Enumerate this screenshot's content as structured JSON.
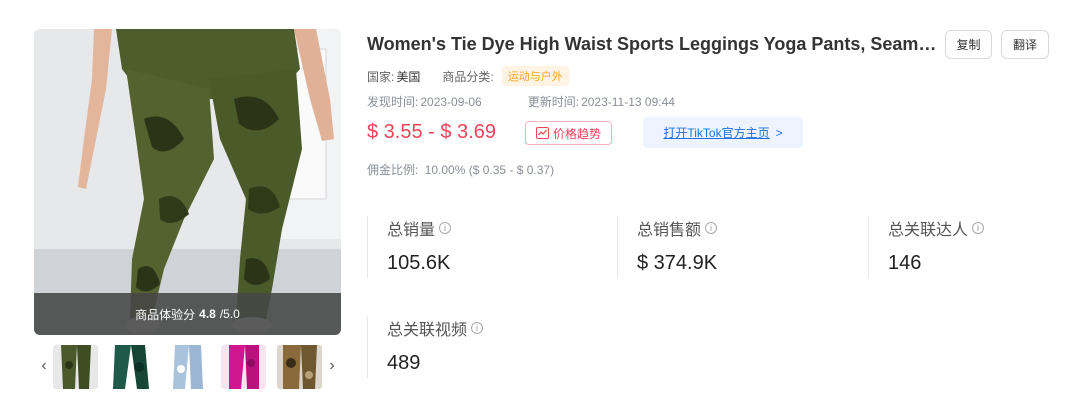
{
  "product": {
    "title": "Women's Tie Dye High Waist Sports Leggings Yoga Pants, Seamle...",
    "copy_label": "复制",
    "translate_label": "翻译",
    "country_label": "国家:",
    "country_value": "美国",
    "category_label": "商品分类:",
    "category_value": "运动与户外",
    "discovered_label": "发现时间:",
    "discovered_value": "2023-09-06",
    "updated_label": "更新时间:",
    "updated_value": "2023-11-13 09:44",
    "price": "$ 3.55 - $ 3.69",
    "trend_label": "价格趋势",
    "tiktok_label": "打开TikTok官方主页",
    "tiktok_arrow": ">",
    "commission_label": "佣金比例:",
    "commission_value": "10.00% ($ 0.35 - $ 0.37)",
    "score_label": "商品体验分",
    "score_value": "4.8",
    "score_max": "/5.0"
  },
  "stats": [
    {
      "label": "总销量",
      "value": "105.6K"
    },
    {
      "label": "总销售额",
      "value": "$ 374.9K"
    },
    {
      "label": "总关联达人",
      "value": "146"
    },
    {
      "label": "总关联视频",
      "value": "489"
    }
  ],
  "thumbnails": [
    {
      "color": "#4a5a2a"
    },
    {
      "color": "#1f5a48"
    },
    {
      "color": "#a9c3dd"
    },
    {
      "color": "#d0178f"
    },
    {
      "color": "#8a6a3a"
    }
  ],
  "colors": {
    "price": "#f0435a",
    "link": "#1f6fe5",
    "category_tag_bg": "#fff4e3",
    "category_tag_text": "#f5a623"
  },
  "nav": {
    "prev": "‹",
    "next": "›"
  }
}
